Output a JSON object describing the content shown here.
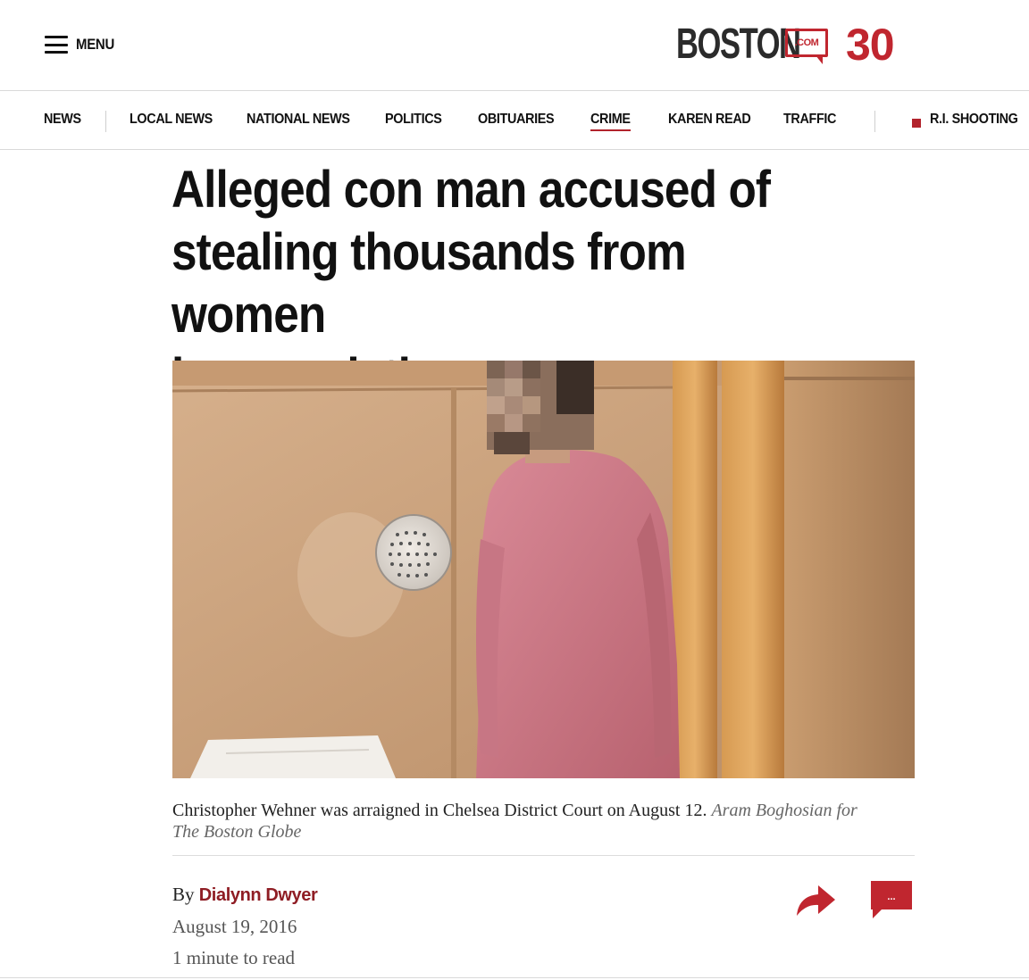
{
  "header": {
    "menu_label": "MENU",
    "logo": {
      "word": "BOSTON",
      "com": ".COM",
      "anniversary": "30"
    }
  },
  "nav": {
    "items": [
      {
        "label": "NEWS"
      },
      {
        "label": "LOCAL NEWS"
      },
      {
        "label": "NATIONAL NEWS"
      },
      {
        "label": "POLITICS"
      },
      {
        "label": "OBITUARIES"
      },
      {
        "label": "CRIME",
        "active": true
      },
      {
        "label": "KAREN READ"
      },
      {
        "label": "TRAFFIC"
      }
    ],
    "breaking": "R.I. SHOOTING"
  },
  "article": {
    "headline_lines": [
      "Alleged con man accused of",
      "stealing thousands from women",
      "he was dating"
    ],
    "caption_text": "Christopher Wehner was arraigned in Chelsea District Court on August 12.",
    "caption_credit": "Aram Boghosian for The Boston Globe",
    "byline_prefix": "By",
    "author": "Dialynn Dwyer",
    "date": "August 19, 2016",
    "read_time": "1 minute to read"
  },
  "actions": {
    "comment_label": "..."
  },
  "colors": {
    "brand_red": "#c0262f",
    "author_red": "#8f1d24"
  }
}
